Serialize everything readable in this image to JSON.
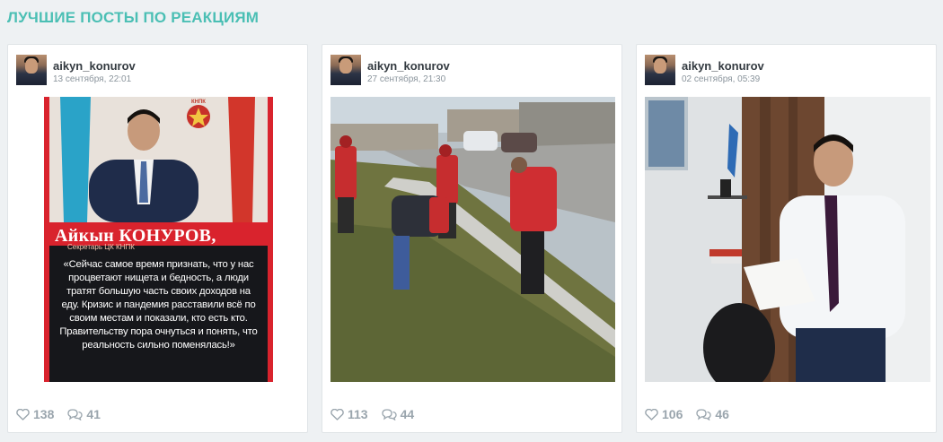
{
  "section": {
    "title": "ЛУЧШИЕ ПОСТЫ ПО РЕАКЦИЯМ"
  },
  "posts": [
    {
      "username": "aikyn_konurov",
      "date": "13 сентября, 22:01",
      "likes": "138",
      "comments": "41",
      "poster": {
        "name": "Айкын КОНУРОВ,",
        "subtitle": "Секретарь ЦК КНПК",
        "emblem": "КНПК",
        "quote": "«Сейчас самое время признать, что у нас процветают нищета и бедность, а люди тратят большую часть своих доходов на еду. Кризис и пандемия расставили всё по своим местам и показали, кто есть кто. Правительству пора очнуться и понять, что реальность сильно поменялась!»"
      }
    },
    {
      "username": "aikyn_konurov",
      "date": "27 сентября, 21:30",
      "likes": "113",
      "comments": "44"
    },
    {
      "username": "aikyn_konurov",
      "date": "02 сентября, 05:39",
      "likes": "106",
      "comments": "46"
    }
  ],
  "icons": {
    "like": "heart-icon",
    "comment": "comment-bubbles-icon"
  },
  "colors": {
    "accent": "#4bbfb4",
    "stat": "#9aa5ad",
    "card_bg": "#ffffff"
  }
}
